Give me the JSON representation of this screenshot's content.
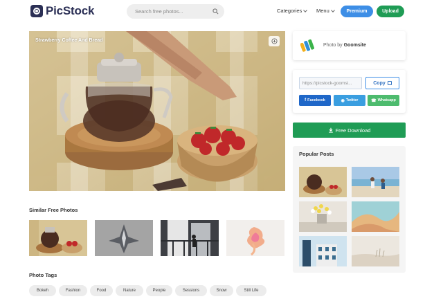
{
  "header": {
    "logo": "PicStock",
    "search_placeholder": "Search free photos...",
    "nav": {
      "categories": "Categories",
      "menu": "Menu"
    },
    "premium_label": "Premium",
    "upload_label": "Upload"
  },
  "photo": {
    "title": "Strawberry Coffee And Bread"
  },
  "author": {
    "prefix": "Photo by",
    "name": "Goomsite"
  },
  "share": {
    "url_value": "https://picstock-goomsi...",
    "copy_label": "Copy",
    "facebook_label": "Facebook",
    "twitter_label": "Twitter",
    "whatsapp_label": "Whatsapp"
  },
  "download_label": "Free Download",
  "popular": {
    "title": "Popular Posts"
  },
  "similar": {
    "title": "Similar Free Photos"
  },
  "tags": {
    "title": "Photo Tags",
    "items": [
      "Bokeh",
      "Fashion",
      "Food",
      "Nature",
      "People",
      "Sessions",
      "Snow",
      "Still Life"
    ]
  },
  "colors": {
    "brand": "#2b2f55",
    "premium": "#3d8ee6",
    "green": "#1f9c55",
    "facebook": "#1f67c8",
    "twitter": "#3a9ee0",
    "whatsapp": "#4dbb6e"
  },
  "icons": [
    "camera-logo-icon",
    "search-icon",
    "chevron-down-icon",
    "zoom-in-icon",
    "copy-icon",
    "facebook-icon",
    "twitter-icon",
    "whatsapp-icon",
    "download-icon"
  ]
}
